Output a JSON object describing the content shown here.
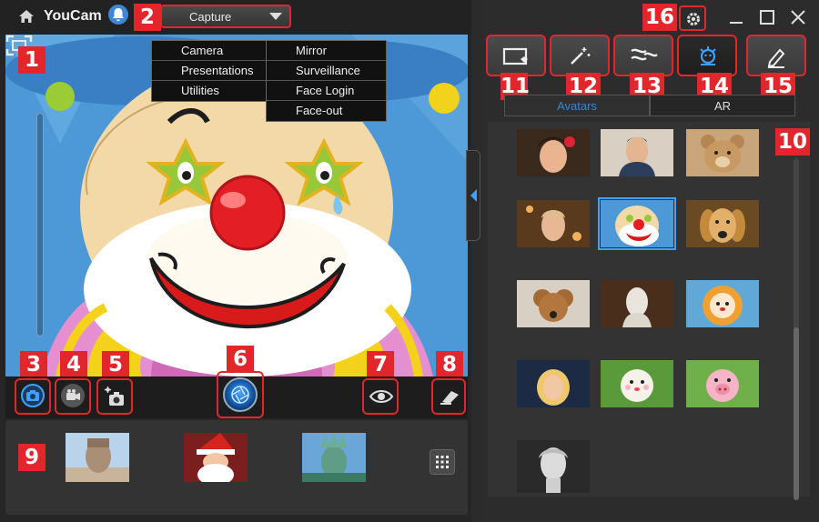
{
  "app": {
    "title": "YouCam"
  },
  "mode_select": {
    "value": "Capture"
  },
  "menu": {
    "col1": [
      "Camera",
      "Presentations",
      "Utilities"
    ],
    "col2": [
      "Mirror",
      "Surveillance",
      "Face Login",
      "Face-out"
    ]
  },
  "badges": {
    "b1": "1",
    "b2": "2",
    "b3": "3",
    "b4": "4",
    "b5": "5",
    "b6": "6",
    "b7": "7",
    "b8": "8",
    "b9": "9",
    "b10": "10",
    "b11": "11",
    "b12": "12",
    "b13": "13",
    "b14": "14",
    "b15": "15",
    "b16": "16"
  },
  "tabs": {
    "avatars": "Avatars",
    "ar": "AR"
  },
  "icons": {
    "home": "home-icon",
    "bell": "bell-icon",
    "fullscreen": "fullscreen-icon",
    "camera": "camera-icon",
    "video": "video-camera-icon",
    "timer_photo": "timed-capture-icon",
    "shutter": "shutter-icon",
    "eye": "eye-icon",
    "eraser": "eraser-icon",
    "grid": "grid-icon",
    "settings": "gear-icon",
    "tool_frame": "frame-icon",
    "tool_magic": "magic-wand-icon",
    "tool_distort": "distortion-icon",
    "tool_avatar": "avatar-icon",
    "tool_draw": "pen-icon"
  },
  "colors": {
    "accent": "#3ea0ff",
    "badge": "#e3262b",
    "panel": "#2c2c2c"
  }
}
